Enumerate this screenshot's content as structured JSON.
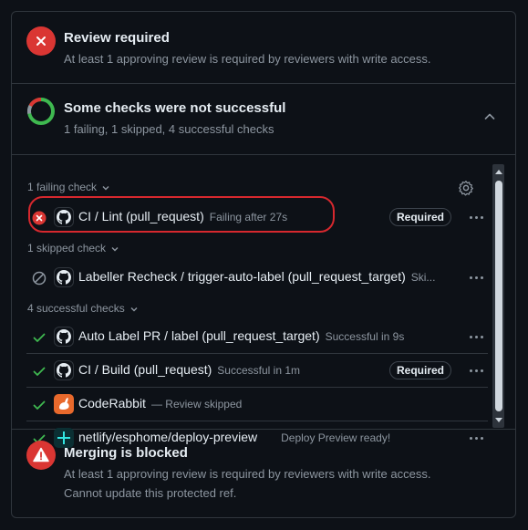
{
  "review": {
    "title": "Review required",
    "subtitle": "At least 1 approving review is required by reviewers with write access."
  },
  "checks_summary": {
    "title": "Some checks were not successful",
    "subtitle": "1 failing, 1 skipped, 4 successful checks"
  },
  "groups": {
    "failing": "1 failing check",
    "skipped": "1 skipped check",
    "successful": "4 successful checks"
  },
  "rows": [
    {
      "name": "CI / Lint (pull_request)",
      "desc": "Failing after 27s",
      "badge": "Required",
      "status": "failure"
    },
    {
      "name": "Labeller Recheck / trigger-auto-label (pull_request_target)",
      "desc": "Ski...",
      "badge": "",
      "status": "skipped"
    },
    {
      "name": "Auto Label PR / label (pull_request_target)",
      "desc": "Successful in 9s",
      "badge": "",
      "status": "success"
    },
    {
      "name": "CI / Build (pull_request)",
      "desc": "Successful in 1m",
      "badge": "Required",
      "status": "success"
    },
    {
      "name": "CodeRabbit",
      "desc": "— Review skipped",
      "badge": "",
      "status": "success"
    },
    {
      "name": "netlify/esphome/deploy-preview",
      "desc": "Deploy Preview ready!",
      "badge": "",
      "status": "success"
    }
  ],
  "merge": {
    "title": "Merging is blocked",
    "line1": "At least 1 approving review is required by reviewers with write access.",
    "line2": "Cannot update this protected ref."
  },
  "colors": {
    "background": "#0d1117",
    "border": "#30363d",
    "danger": "#da3633",
    "success": "#3fb950",
    "muted": "#8d96a0",
    "highlight": "#d6282e"
  },
  "icons": [
    "x-icon",
    "status-donut-icon",
    "chevron-up-icon",
    "chevron-down-icon",
    "gear-icon",
    "github-icon",
    "skip-icon",
    "check-icon",
    "coderabbit-icon",
    "netlify-icon",
    "kebab-icon",
    "alert-icon"
  ]
}
